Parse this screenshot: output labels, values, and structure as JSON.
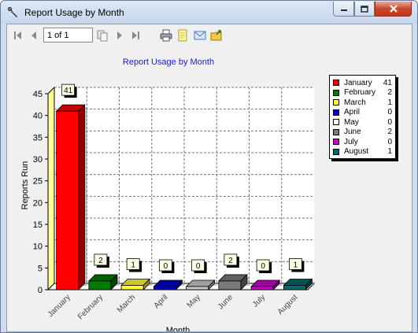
{
  "window": {
    "title": "Report Usage by Month"
  },
  "toolbar": {
    "page_value": "1 of 1",
    "icons": [
      "first-page-icon",
      "previous-page-icon",
      "copy-pages-icon",
      "next-page-icon",
      "last-page-icon",
      "print-icon",
      "page-setup-icon",
      "email-icon",
      "export-icon"
    ]
  },
  "report": {
    "title": "Report Usage by Month"
  },
  "legend": [
    {
      "name": "January",
      "value": "41",
      "color": "#ff0000"
    },
    {
      "name": "February",
      "value": "2",
      "color": "#007a00"
    },
    {
      "name": "March",
      "value": "1",
      "color": "#ffff33"
    },
    {
      "name": "April",
      "value": "0",
      "color": "#0000cc"
    },
    {
      "name": "May",
      "value": "0",
      "color": "#ffffff"
    },
    {
      "name": "June",
      "value": "2",
      "color": "#7a7a7a"
    },
    {
      "name": "July",
      "value": "0",
      "color": "#cc00cc"
    },
    {
      "name": "August",
      "value": "1",
      "color": "#006b6b"
    }
  ],
  "chart_data": {
    "type": "bar",
    "categories": [
      "January",
      "February",
      "March",
      "April",
      "May",
      "June",
      "July",
      "August"
    ],
    "values": [
      41,
      2,
      1,
      0,
      0,
      2,
      0,
      1
    ],
    "colors": [
      "#ff0000",
      "#007a00",
      "#ffff33",
      "#0000cc",
      "#cccccc",
      "#7a7a7a",
      "#cc00cc",
      "#006b6b"
    ],
    "ylabel": "Reports Run",
    "xlabel": "Month",
    "ylim": [
      0,
      45
    ],
    "yticks": [
      0,
      5,
      10,
      15,
      20,
      25,
      30,
      35,
      40,
      45
    ],
    "grid": true,
    "three_d": true,
    "data_labels": true,
    "legend_position": "right"
  }
}
